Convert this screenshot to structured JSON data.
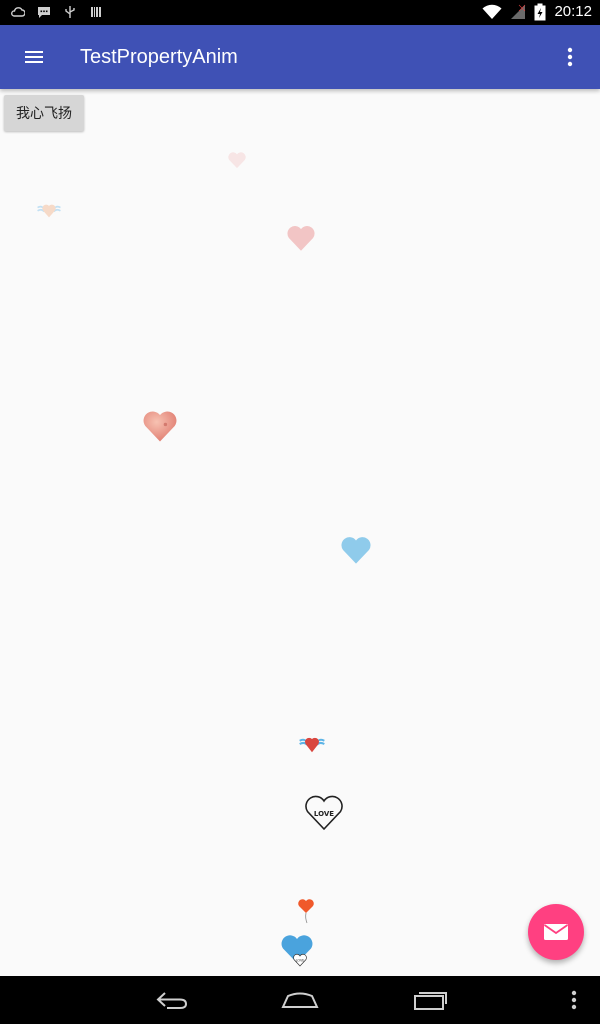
{
  "status_bar": {
    "time": "20:12",
    "icons": [
      "cloud-icon",
      "message-icon",
      "usb-icon",
      "barcode-icon",
      "wifi-icon",
      "signal-off-icon",
      "battery-charging-icon"
    ]
  },
  "toolbar": {
    "title": "TestPropertyAnim",
    "menu_icon": "menu-icon",
    "overflow_icon": "more-vert-icon"
  },
  "main": {
    "button_label": "我心飞扬",
    "hearts": [
      {
        "name": "heart-pale-pink",
        "color": "#f4c0c0"
      },
      {
        "name": "heart-winged-light",
        "color": "#f5c6a8"
      },
      {
        "name": "heart-pink",
        "color": "#efb0b0"
      },
      {
        "name": "heart-coral",
        "color": "#e8867c"
      },
      {
        "name": "heart-light-blue",
        "color": "#8fcbeb"
      },
      {
        "name": "heart-winged-red",
        "color": "#d9463f"
      },
      {
        "name": "heart-love-outline",
        "color": "#222222",
        "text": "LOVE"
      },
      {
        "name": "heart-balloon-orange",
        "color": "#f0592b"
      },
      {
        "name": "heart-blue-love",
        "color": "#4aa3dd",
        "text": "LOVE"
      }
    ]
  },
  "fab": {
    "icon": "email-icon",
    "color": "#ff4081"
  },
  "nav": {
    "back": "back-icon",
    "home": "home-icon",
    "recents": "recents-icon",
    "menu": "nav-menu-icon"
  }
}
